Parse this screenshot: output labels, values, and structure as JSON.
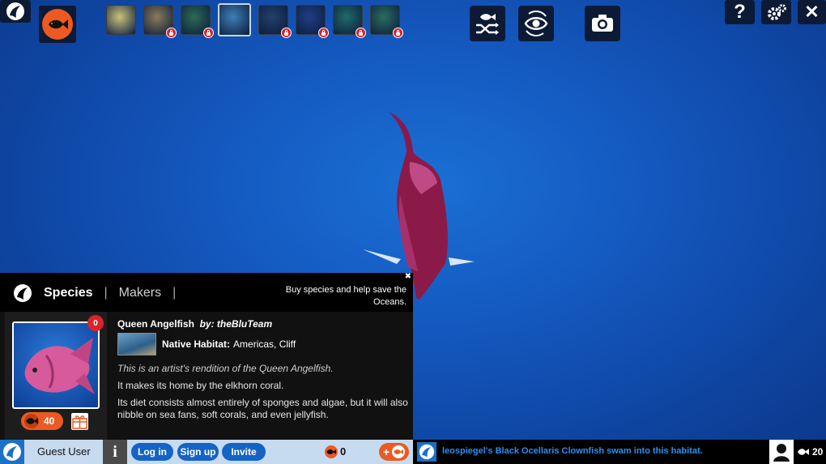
{
  "top": {
    "help_label": "?",
    "close_label": "✕",
    "habitats": [
      {
        "name": "habitat-1",
        "color": "#c9c27a",
        "locked": false,
        "selected": false
      },
      {
        "name": "habitat-2",
        "color": "#8a7b5a",
        "locked": true,
        "selected": false
      },
      {
        "name": "habitat-3",
        "color": "#2d6a55",
        "locked": true,
        "selected": false
      },
      {
        "name": "habitat-4",
        "color": "#3d7fb6",
        "locked": false,
        "selected": true
      },
      {
        "name": "habitat-5",
        "color": "#22406a",
        "locked": true,
        "selected": false
      },
      {
        "name": "habitat-6",
        "color": "#213e86",
        "locked": true,
        "selected": false
      },
      {
        "name": "habitat-7",
        "color": "#1f6a6a",
        "locked": true,
        "selected": false
      },
      {
        "name": "habitat-8",
        "color": "#2a6c5e",
        "locked": true,
        "selected": false
      }
    ]
  },
  "panel": {
    "tabs": {
      "species": "Species",
      "makers": "Makers",
      "sep": "|"
    },
    "promo": "Buy species and help save the Oceans.",
    "close": "✖",
    "card": {
      "count": "0",
      "price": "40"
    },
    "species": {
      "name": "Queen Angelfish",
      "by": "by: theBluTeam",
      "habitat_label": "Native Habitat:",
      "habitat_value": "Americas, Cliff",
      "desc_italic": "This is an artist's rendition of the Queen Angelfish.",
      "desc1": "It makes its home by the elkhorn coral.",
      "desc2": "Its diet consists almost entirely of sponges and algae, but it will also nibble on sea fans, soft corals, and even jellyfish."
    }
  },
  "bottom_bar": {
    "user": "Guest User",
    "info": "i",
    "login": "Log in",
    "signup": "Sign up",
    "invite": "Invite",
    "coins": "0",
    "plus": "+"
  },
  "feed": {
    "message": "leospiegel's Black Ocellaris Clownfish swam into this habitat.",
    "fish_count": "20"
  },
  "colors": {
    "accent": "#ec5a22",
    "ocean": "#1459c0",
    "link": "#1463c6",
    "lock": "#d8242c"
  }
}
